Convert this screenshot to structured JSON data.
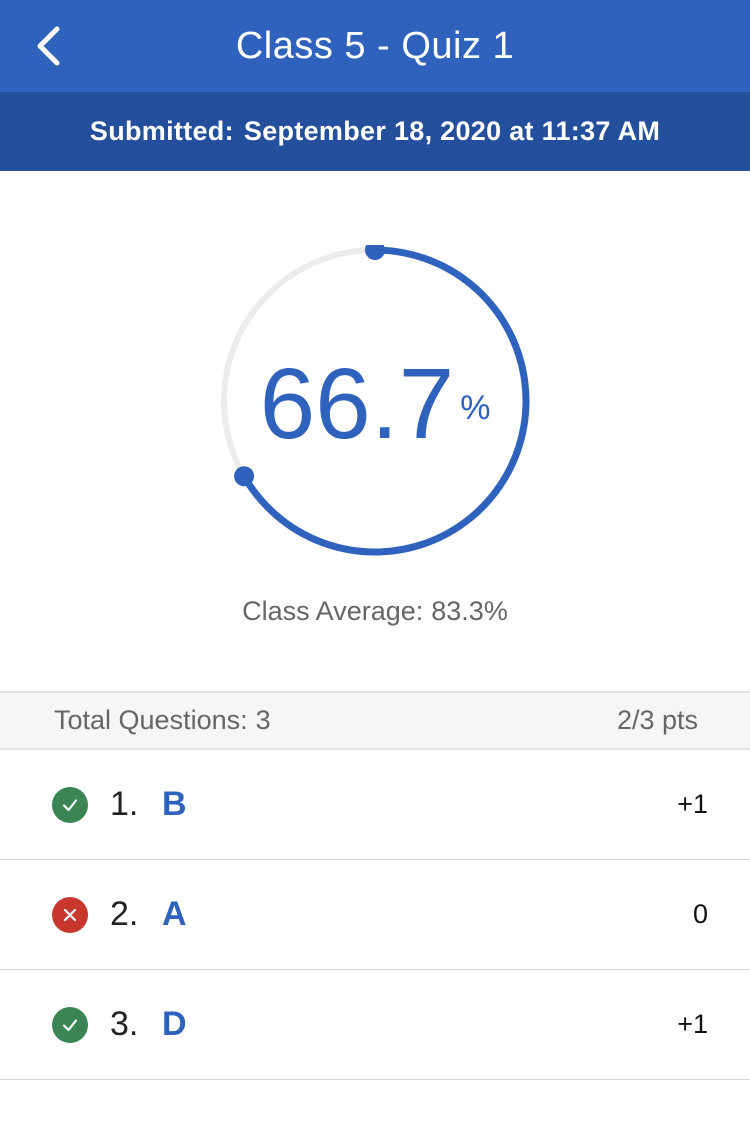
{
  "header": {
    "title": "Class 5 - Quiz 1",
    "back_icon": "chevron-left-icon"
  },
  "submission": {
    "label": "Submitted:",
    "value": "September 18, 2020 at 11:37 AM"
  },
  "score": {
    "value": "66.7",
    "unit": "%",
    "fraction": 0.667
  },
  "class_average": {
    "label": "Class Average:",
    "value": "83.3%"
  },
  "summary": {
    "total_label": "Total Questions:",
    "total_value": "3",
    "points": "2/3 pts"
  },
  "questions": [
    {
      "number": "1.",
      "answer": "B",
      "points": "+1",
      "status": "correct",
      "icon": "check-circle-icon"
    },
    {
      "number": "2.",
      "answer": "A",
      "points": "0",
      "status": "incorrect",
      "icon": "x-circle-icon"
    },
    {
      "number": "3.",
      "answer": "D",
      "points": "+1",
      "status": "correct",
      "icon": "check-circle-icon"
    }
  ],
  "colors": {
    "header_bg": "#2f62bd",
    "subheader_bg": "#244f9c",
    "accent": "#2f62bd",
    "track": "#ececec",
    "correct": "#3a8553",
    "incorrect": "#c8372d"
  }
}
